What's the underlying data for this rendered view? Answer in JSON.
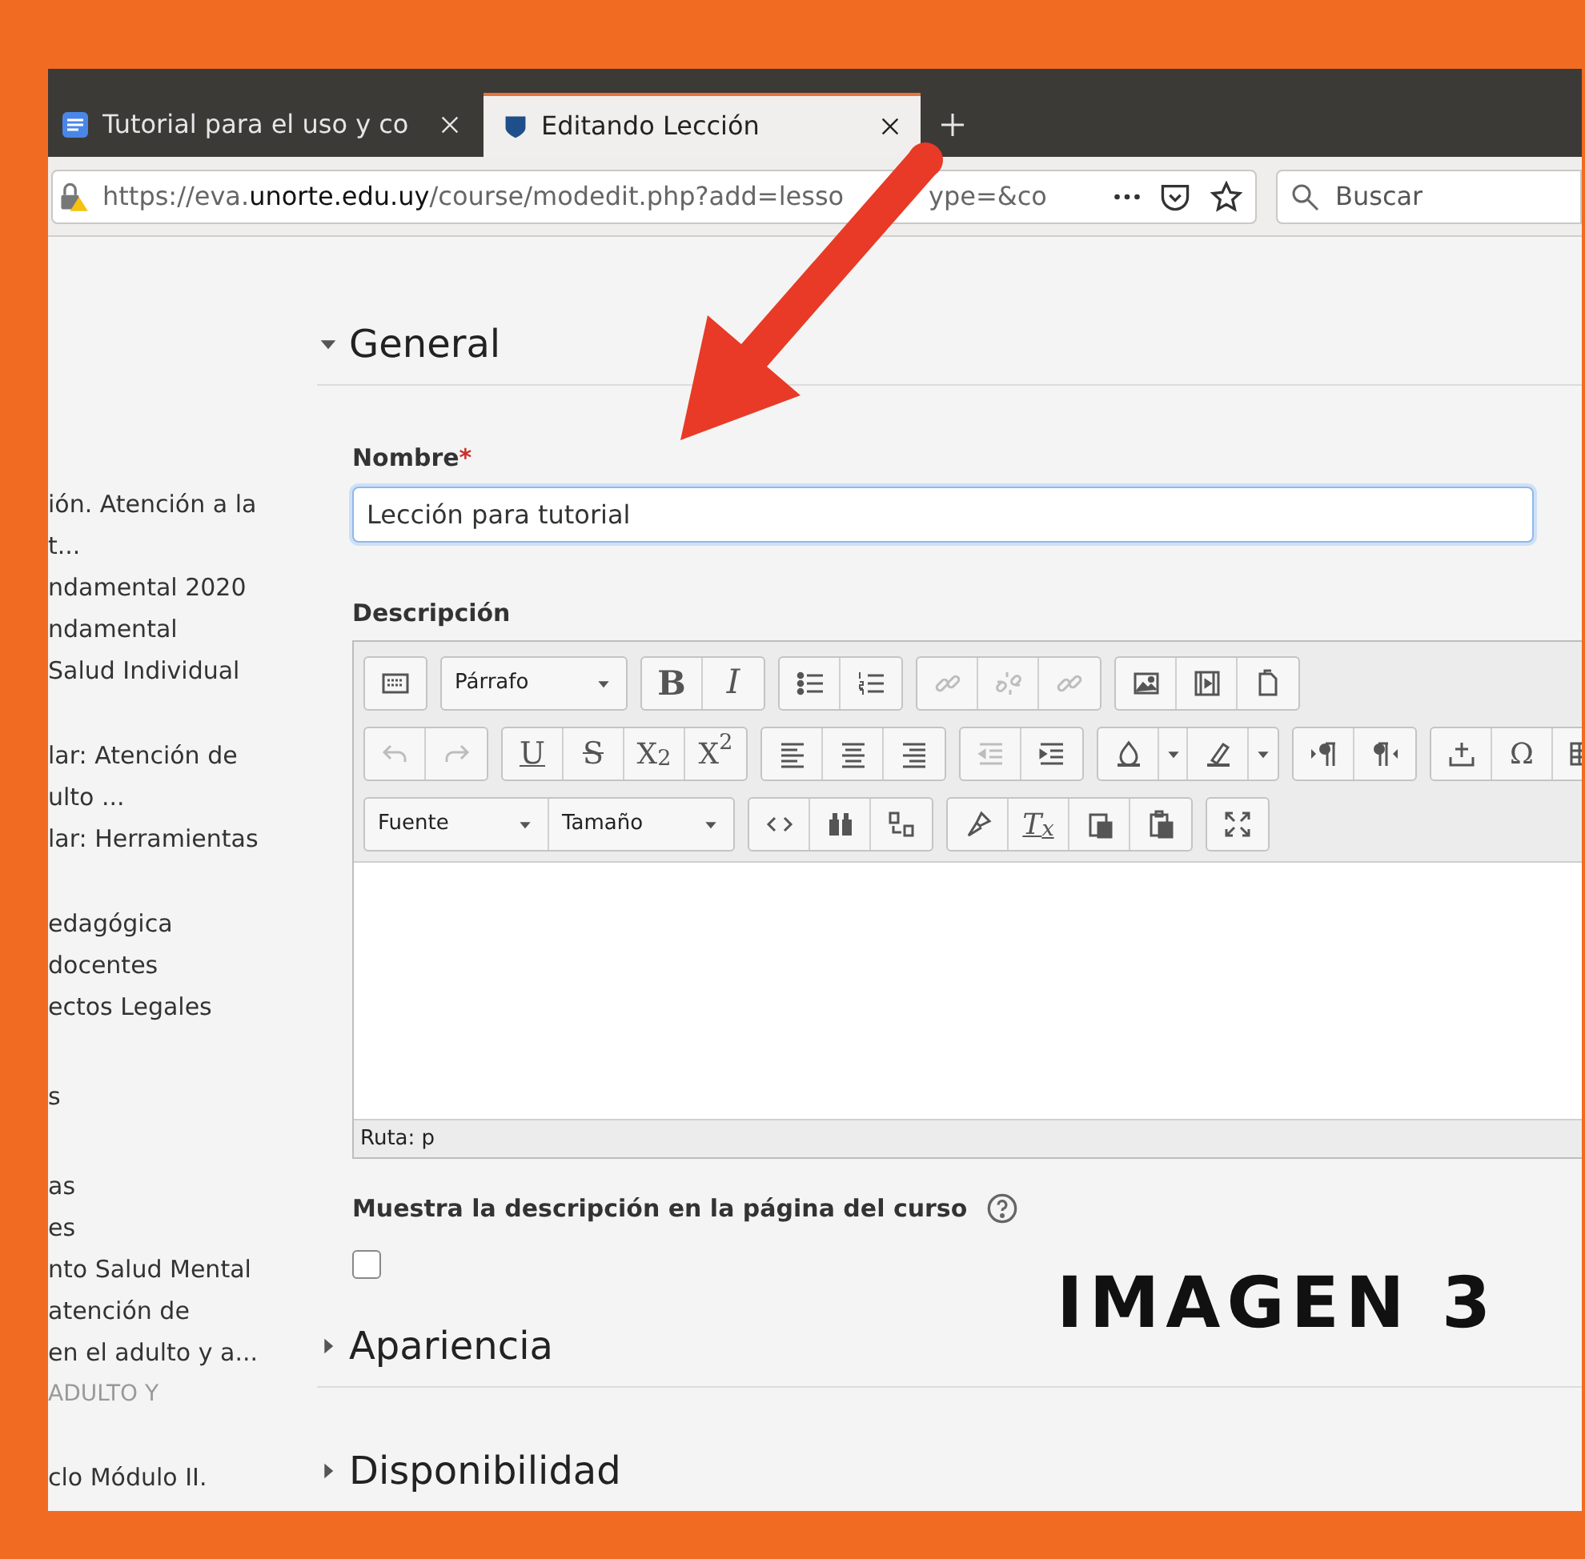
{
  "browser": {
    "tabs": [
      {
        "title": "Tutorial para el uso y co",
        "selected": false
      },
      {
        "title": "Editando Lección",
        "selected": true
      }
    ],
    "address": {
      "scheme": "https://eva.",
      "domain": "unorte.edu.uy",
      "path": "/course/modedit.php?add=lesso",
      "tail": "ype=&co"
    },
    "search": {
      "placeholder": "Buscar"
    }
  },
  "sidebar": {
    "items": [
      {
        "kind": "link",
        "lines": [
          "ión. Atención a la",
          "t..."
        ]
      },
      {
        "kind": "link",
        "lines": [
          "ndamental 2020"
        ]
      },
      {
        "kind": "link",
        "lines": [
          "ndamental"
        ]
      },
      {
        "kind": "link",
        "lines": [
          "Salud Individual"
        ]
      },
      {
        "kind": "link",
        "lines": [
          "lar: Atención de",
          "ulto ..."
        ]
      },
      {
        "kind": "link",
        "lines": [
          "lar: Herramientas"
        ]
      },
      {
        "kind": "link",
        "lines": [
          "edagógica"
        ]
      },
      {
        "kind": "link",
        "lines": [
          "docentes"
        ]
      },
      {
        "kind": "link",
        "lines": [
          "ectos Legales"
        ]
      },
      {
        "kind": "link",
        "lines": [
          "s"
        ]
      },
      {
        "kind": "link",
        "lines": [
          "as"
        ]
      },
      {
        "kind": "link",
        "lines": [
          "es"
        ]
      },
      {
        "kind": "link",
        "lines": [
          "nto Salud Mental"
        ]
      },
      {
        "kind": "link",
        "lines": [
          "atención de",
          "en el adulto y a..."
        ]
      },
      {
        "kind": "heading",
        "lines": [
          "ADULTO Y"
        ]
      },
      {
        "kind": "link",
        "lines": [
          "clo Módulo II."
        ]
      }
    ]
  },
  "form": {
    "sections": [
      {
        "title": "General",
        "expanded": true
      },
      {
        "title": "Apariencia",
        "expanded": false
      },
      {
        "title": "Disponibilidad",
        "expanded": false
      }
    ],
    "name_field": {
      "label": "Nombre",
      "required_mark": "*",
      "value": "Lección para tutorial"
    },
    "description": {
      "label": "Descripción",
      "path_label": "Ruta: p",
      "toolbar": [
        [
          [
            {
              "kind": "keyboard",
              "disabled": false
            }
          ],
          [
            {
              "kind": "select",
              "label": "Párrafo",
              "disabled": false
            }
          ],
          [
            {
              "kind": "bold",
              "label": "B",
              "disabled": false
            },
            {
              "kind": "italic",
              "label": "I",
              "disabled": false
            }
          ],
          [
            {
              "kind": "bullets",
              "disabled": false
            },
            {
              "kind": "numbers",
              "disabled": false
            }
          ],
          [
            {
              "kind": "link",
              "disabled": true
            },
            {
              "kind": "unlink",
              "disabled": true
            },
            {
              "kind": "chain",
              "disabled": true
            }
          ],
          [
            {
              "kind": "image",
              "disabled": false
            },
            {
              "kind": "film",
              "disabled": false
            },
            {
              "kind": "files",
              "disabled": false
            }
          ]
        ],
        [
          [
            {
              "kind": "undo",
              "disabled": true
            },
            {
              "kind": "redo",
              "disabled": true
            }
          ],
          [
            {
              "kind": "underline",
              "label": "U",
              "disabled": false
            },
            {
              "kind": "strike",
              "label": "S",
              "disabled": false
            },
            {
              "kind": "text",
              "label": "X$_{2}$",
              "disabled": false
            },
            {
              "kind": "text",
              "label": "X$^{2}$",
              "disabled": false
            }
          ],
          [
            {
              "kind": "alignleft",
              "disabled": false
            },
            {
              "kind": "aligncenter",
              "disabled": false
            },
            {
              "kind": "alignright",
              "disabled": false
            }
          ],
          [
            {
              "kind": "outdent",
              "disabled": true
            },
            {
              "kind": "indent",
              "disabled": false
            }
          ],
          [
            {
              "kind": "fontcolor",
              "disabled": false
            },
            {
              "kind": "caret",
              "disabled": false
            },
            {
              "kind": "highlight",
              "disabled": false
            },
            {
              "kind": "caret",
              "disabled": false
            }
          ],
          [
            {
              "kind": "ltr",
              "disabled": false
            },
            {
              "kind": "rtl",
              "disabled": false
            }
          ],
          [
            {
              "kind": "insert",
              "disabled": false
            },
            {
              "kind": "text",
              "label": "Ω",
              "disabled": false
            },
            {
              "kind": "table",
              "disabled": false
            }
          ]
        ],
        [
          [
            {
              "kind": "select",
              "label": "Fuente",
              "disabled": false
            },
            {
              "kind": "select",
              "label": "Tamaño",
              "disabled": false
            }
          ],
          [
            {
              "kind": "code",
              "disabled": false
            },
            {
              "kind": "binoculars",
              "disabled": false
            },
            {
              "kind": "replace",
              "disabled": false
            }
          ],
          [
            {
              "kind": "brush",
              "disabled": false
            },
            {
              "kind": "clear",
              "label": "T$_{x}$",
              "disabled": false
            },
            {
              "kind": "pastetext",
              "disabled": false
            },
            {
              "kind": "pasteword",
              "disabled": false
            }
          ],
          [
            {
              "kind": "fullscreen",
              "disabled": false
            }
          ]
        ]
      ]
    },
    "show_description": {
      "label": "Muestra la descripción en la página del curso",
      "checked": false
    }
  },
  "overlay_label": "IMAGEN 3"
}
